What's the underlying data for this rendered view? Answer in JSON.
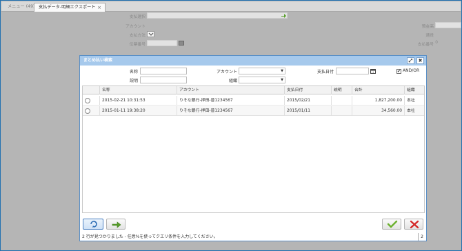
{
  "tabs": [
    {
      "label": "メニュー (49)"
    },
    {
      "label": "支払データ-明細エクスポート",
      "close": "×"
    }
  ],
  "background_form": {
    "payment_select_label": "支払選択",
    "account_label": "アカウント",
    "payment_method_label": "支払方法",
    "slip_no_label": "伝票番号",
    "checking_label": "預金高",
    "transfer_label": "通貨",
    "payment_no_label": "支払番号",
    "payment_no_value": "0"
  },
  "modal": {
    "title": "まとめ払い検索",
    "maximize": "⤢",
    "close": "✖",
    "search": {
      "name_label": "名称",
      "account_label": "アカウント",
      "pay_date_label": "支払日付",
      "description_label": "説明",
      "org_label": "組織",
      "and_or_label": "AND/OR",
      "and_or_checked": "✔"
    },
    "columns": [
      "名称",
      "アカウント",
      "支払日付",
      "説明",
      "合計",
      "組織"
    ],
    "rows": [
      {
        "name": "2015-02-21 10:31:53",
        "account": "りそな銀行-押田-普1234567",
        "date": "2015/02/21",
        "desc": "",
        "total": "1,827,200.00",
        "org": "本社"
      },
      {
        "name": "2015-01-11 19:38:20",
        "account": "りそな銀行-押田-普1234567",
        "date": "2015/01/11",
        "desc": "",
        "total": "34,560.00",
        "org": "本社"
      }
    ],
    "status_text": "2 行が見つかりました - 任意%を使ってクエリ条件を入力してください。",
    "status_count": "2"
  },
  "icons": {
    "refresh": "refresh-icon",
    "zoom": "zoom-across-icon",
    "ok": "ok-icon",
    "cancel": "cancel-icon"
  },
  "colors": {
    "title_bar": "#a6c9ec",
    "ok_green": "#6ab02c",
    "cancel_red": "#d42a2a"
  }
}
